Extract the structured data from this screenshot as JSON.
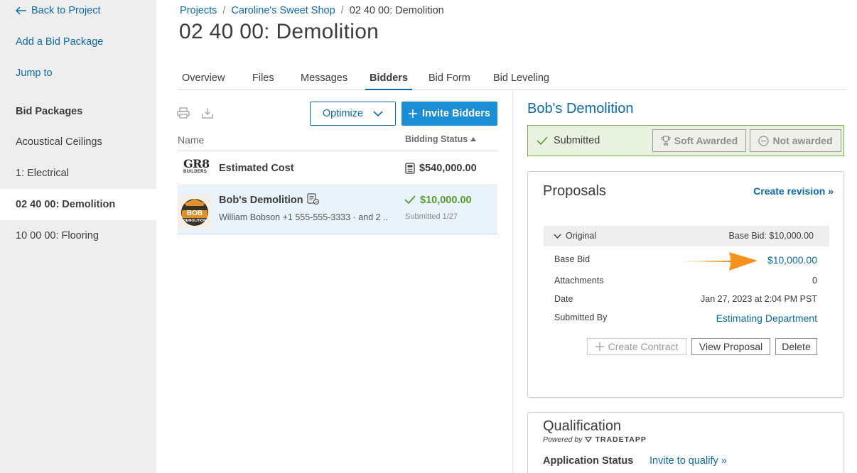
{
  "sidebar": {
    "back_label": "Back to Project",
    "add_label": "Add a Bid Package",
    "jump_label": "Jump to",
    "section_title": "Bid Packages",
    "items": [
      {
        "label": "Acoustical Ceilings"
      },
      {
        "label": "1: Electrical"
      },
      {
        "label": "02 40 00: Demolition"
      },
      {
        "label": "10 00 00: Flooring"
      }
    ]
  },
  "breadcrumb": {
    "items": [
      "Projects",
      "Caroline's Sweet Shop",
      "02 40 00: Demolition"
    ],
    "separator": "/"
  },
  "page": {
    "title": "02 40 00: Demolition"
  },
  "tabs": [
    {
      "label": "Overview"
    },
    {
      "label": "Files"
    },
    {
      "label": "Messages"
    },
    {
      "label": "Bidders"
    },
    {
      "label": "Bid Form"
    },
    {
      "label": "Bid Leveling"
    }
  ],
  "toolbar": {
    "optimize_label": "Optimize",
    "invite_label": "Invite Bidders"
  },
  "table": {
    "col_name": "Name",
    "col_status": "Bidding Status",
    "rows": [
      {
        "title": "Estimated Cost",
        "amount": "$540,000.00",
        "logo_text": "GR8",
        "logo_sub": "BUILDERS"
      },
      {
        "title": "Bob's Demolition",
        "contact": "William Bobson +1 555-555-3333 · and 2 ...",
        "amount": "$10,000.00",
        "status": "Submitted 1/27",
        "logo_text": "BOB",
        "logo_sub": "DEMOLITION"
      }
    ]
  },
  "detail": {
    "bidder_name": "Bob's Demolition",
    "status_submitted": "Submitted",
    "soft_awarded": "Soft Awarded",
    "not_awarded": "Not awarded",
    "proposals": {
      "title": "Proposals",
      "create_revision": "Create revision",
      "original_label": "Original",
      "original_base": "Base Bid: $10,000.00",
      "fields": [
        {
          "label": "Base Bid",
          "value": "$10,000.00"
        },
        {
          "label": "Attachments",
          "value": "0"
        },
        {
          "label": "Date",
          "value": "Jan 27, 2023 at 2:04 PM PST"
        },
        {
          "label": "Submitted By",
          "value": "Estimating Department"
        }
      ],
      "create_contract": "Create Contract",
      "view_proposal": "View Proposal",
      "delete": "Delete"
    },
    "qualification": {
      "title": "Qualification",
      "powered_by": "Powered by",
      "brand": "TRADETAPP",
      "app_status_label": "Application Status",
      "invite_label": "Invite to qualify"
    }
  },
  "colors": {
    "link": "#0b6aa8",
    "primary_button": "#1b8ed6",
    "success": "#5a9a2e",
    "status_bg": "#e9f1e1",
    "status_border": "#7cad47",
    "selected_row": "#e9f3fb",
    "annotation_arrow": "#f5921e"
  }
}
